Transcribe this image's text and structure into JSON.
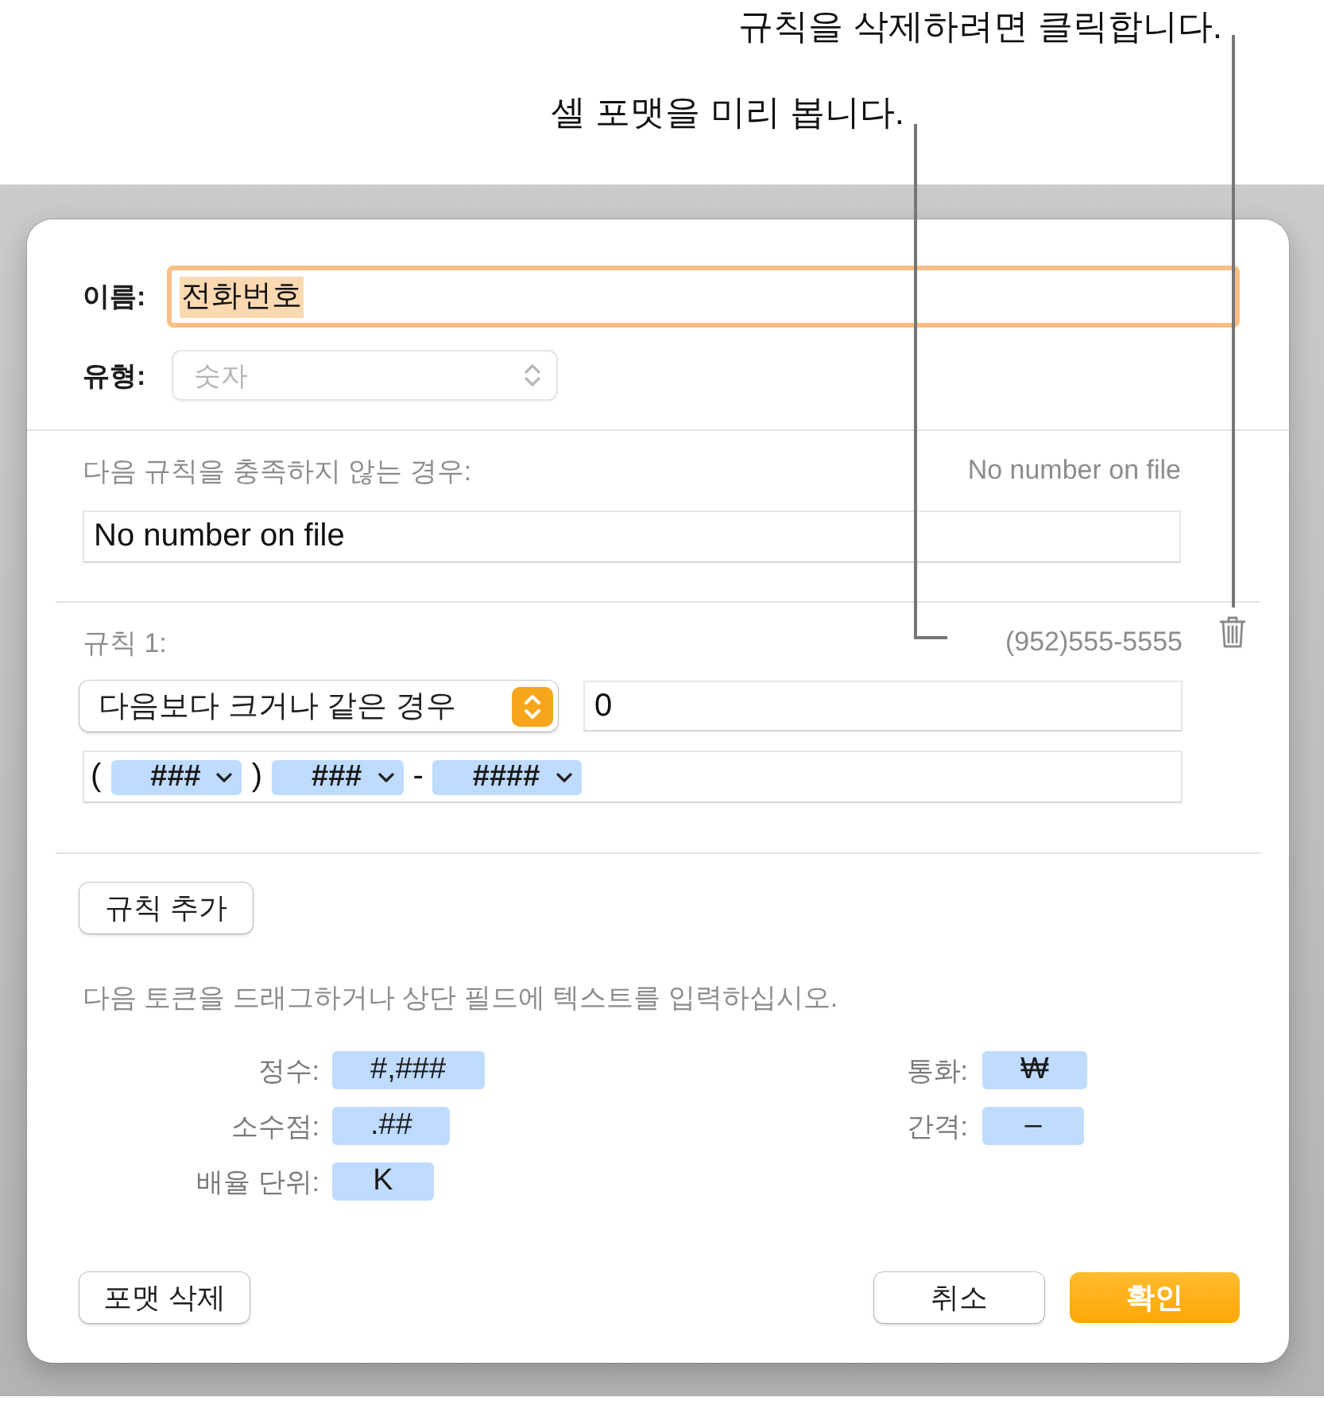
{
  "callouts": [
    {
      "text": "규칙을 삭제하려면 클릭합니다."
    },
    {
      "text": "셀 포맷을 미리 봅니다."
    }
  ],
  "dialog": {
    "name_field": {
      "label": "이름:",
      "value": "전화번호",
      "focused": true,
      "value_selected": true
    },
    "type_field": {
      "label": "유형:",
      "value": "숫자",
      "disabled": true
    },
    "fallback": {
      "label": "다음 규칙을 충족하지 않는 경우:",
      "preview": "No number on file",
      "value": "No number on file"
    },
    "rules": [
      {
        "label": "규칙 1:",
        "preview": "(952)555-5555",
        "condition": "다음보다 크거나 같은 경우",
        "value": "0",
        "format": [
          {
            "kind": "text",
            "text": "("
          },
          {
            "kind": "token",
            "text": "###"
          },
          {
            "kind": "text",
            "text": ")"
          },
          {
            "kind": "token",
            "text": "###"
          },
          {
            "kind": "text",
            "text": "-"
          },
          {
            "kind": "token",
            "text": "####"
          }
        ]
      }
    ],
    "add_rule_button": {
      "label": "규칙 추가"
    },
    "hint": "다음 토큰을 드래그하거나 상단 필드에 텍스트를 입력하십시오.",
    "tokens": {
      "left": [
        {
          "label": "정수:",
          "token": "#,###"
        },
        {
          "label": "소수점:",
          "token": ".##"
        },
        {
          "label": "배율 단위:",
          "token": "K"
        }
      ],
      "right": [
        {
          "label": "통화:",
          "token": "₩"
        },
        {
          "label": "간격:",
          "token": "–"
        }
      ]
    },
    "buttons": {
      "left": [
        {
          "label": "포맷 삭제",
          "kind": "default"
        }
      ],
      "right": [
        {
          "label": "취소",
          "kind": "default"
        },
        {
          "label": "확인",
          "kind": "primary"
        }
      ]
    }
  }
}
